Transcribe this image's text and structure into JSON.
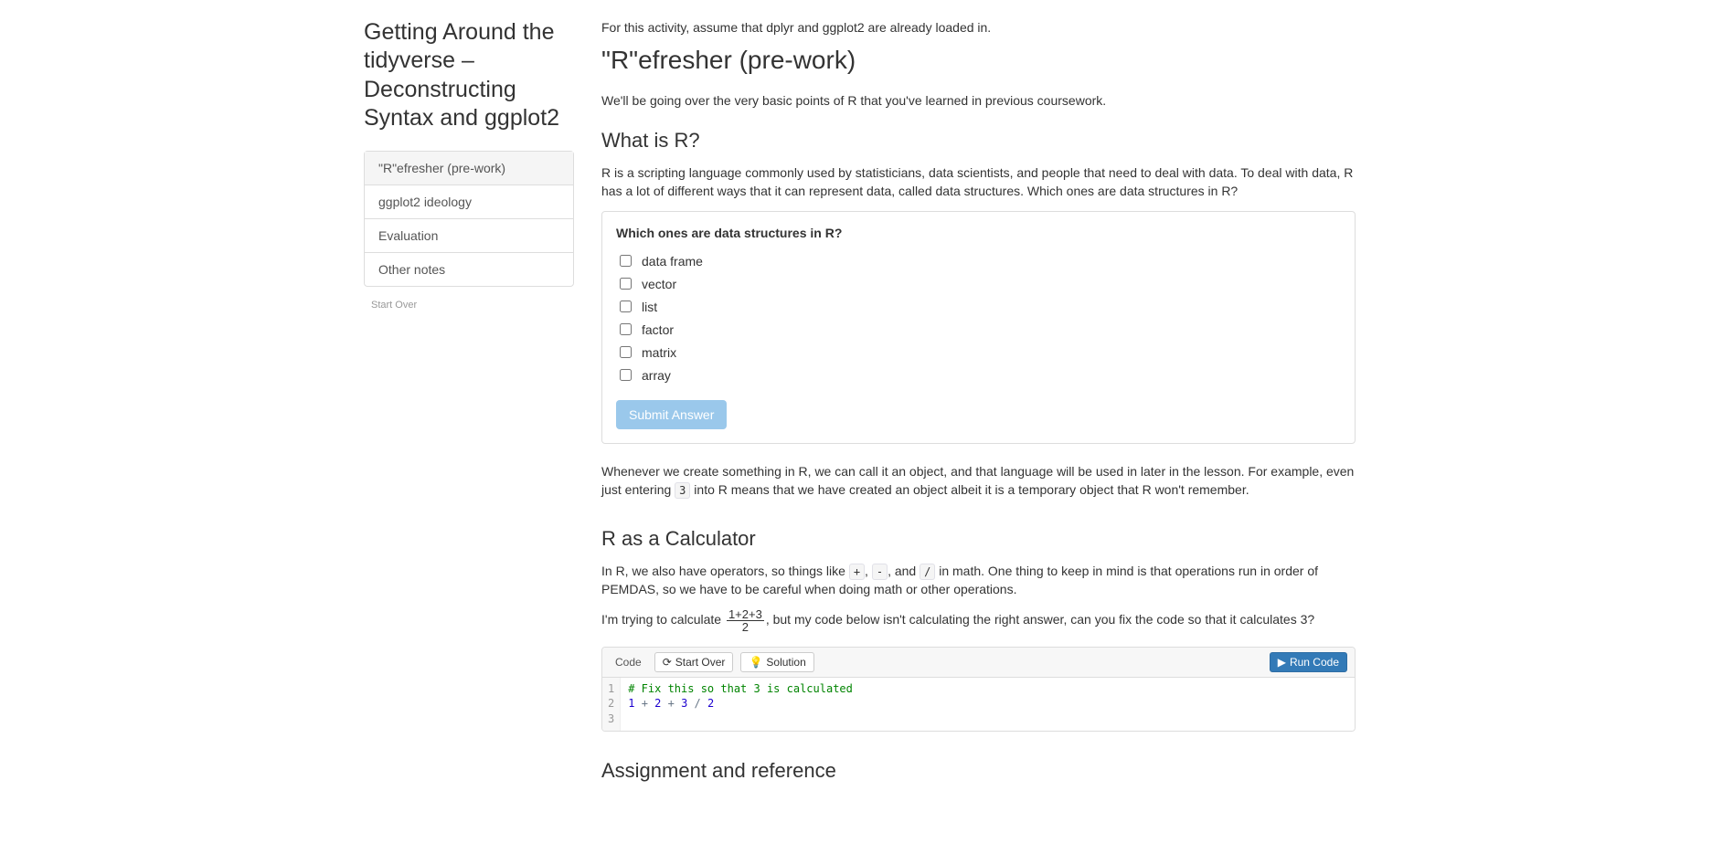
{
  "sidebar": {
    "title": "Getting Around the tidyverse – Deconstructing Syntax and ggplot2",
    "items": [
      {
        "label": "\"R\"efresher (pre-work)",
        "active": true
      },
      {
        "label": "ggplot2 ideology",
        "active": false
      },
      {
        "label": "Evaluation",
        "active": false
      },
      {
        "label": "Other notes",
        "active": false
      }
    ],
    "start_over": "Start Over"
  },
  "main": {
    "intro_note": "For this activity, assume that dplyr and ggplot2 are already loaded in.",
    "section_title": "\"R\"efresher (pre-work)",
    "section_intro": "We'll be going over the very basic points of R that you've learned in previous coursework.",
    "what_is_r": {
      "heading": "What is R?",
      "para": "R is a scripting language commonly used by statisticians, data scientists, and people that need to deal with data. To deal with data, R has a lot of different ways that it can represent data, called data structures. Which ones are data structures in R?"
    },
    "quiz": {
      "question": "Which ones are data structures in R?",
      "options": [
        "data frame",
        "vector",
        "list",
        "factor",
        "matrix",
        "array"
      ],
      "submit_label": "Submit Answer"
    },
    "after_quiz": {
      "pre": "Whenever we create something in R, we can call it an object, and that language will be used in later in the lesson. For example, even just entering ",
      "code": "3",
      "post": " into R means that we have created an object albeit it is a temporary object that R won't remember."
    },
    "calc": {
      "heading": "R as a Calculator",
      "para_pre": "In R, we also have operators, so things like ",
      "op_plus": "+",
      "comma1": ", ",
      "op_minus": "-",
      "comma2": ", and ",
      "op_div": "/",
      "para_post": " in math. One thing to keep in mind is that operations run in order of PEMDAS, so we have to be careful when doing math or other operations.",
      "calc_sentence_pre": "I'm trying to calculate ",
      "fraction_num": "1+2+3",
      "fraction_den": "2",
      "calc_sentence_mid": ", but my code below isn't calculating the right answer, can you fix the code so that it calculates ",
      "answer": "3",
      "calc_sentence_post": "?"
    },
    "code_block": {
      "label": "Code",
      "start_over": "Start Over",
      "solution": "Solution",
      "run": "Run Code",
      "lines": {
        "comment": "# Fix this so that 3 is calculated",
        "n1": "1",
        "n2": "2",
        "n3": "3",
        "n4": "2",
        "plus": " + ",
        "div": " / "
      },
      "gutter": [
        "1",
        "2",
        "3"
      ]
    },
    "assignment_heading": "Assignment and reference"
  }
}
